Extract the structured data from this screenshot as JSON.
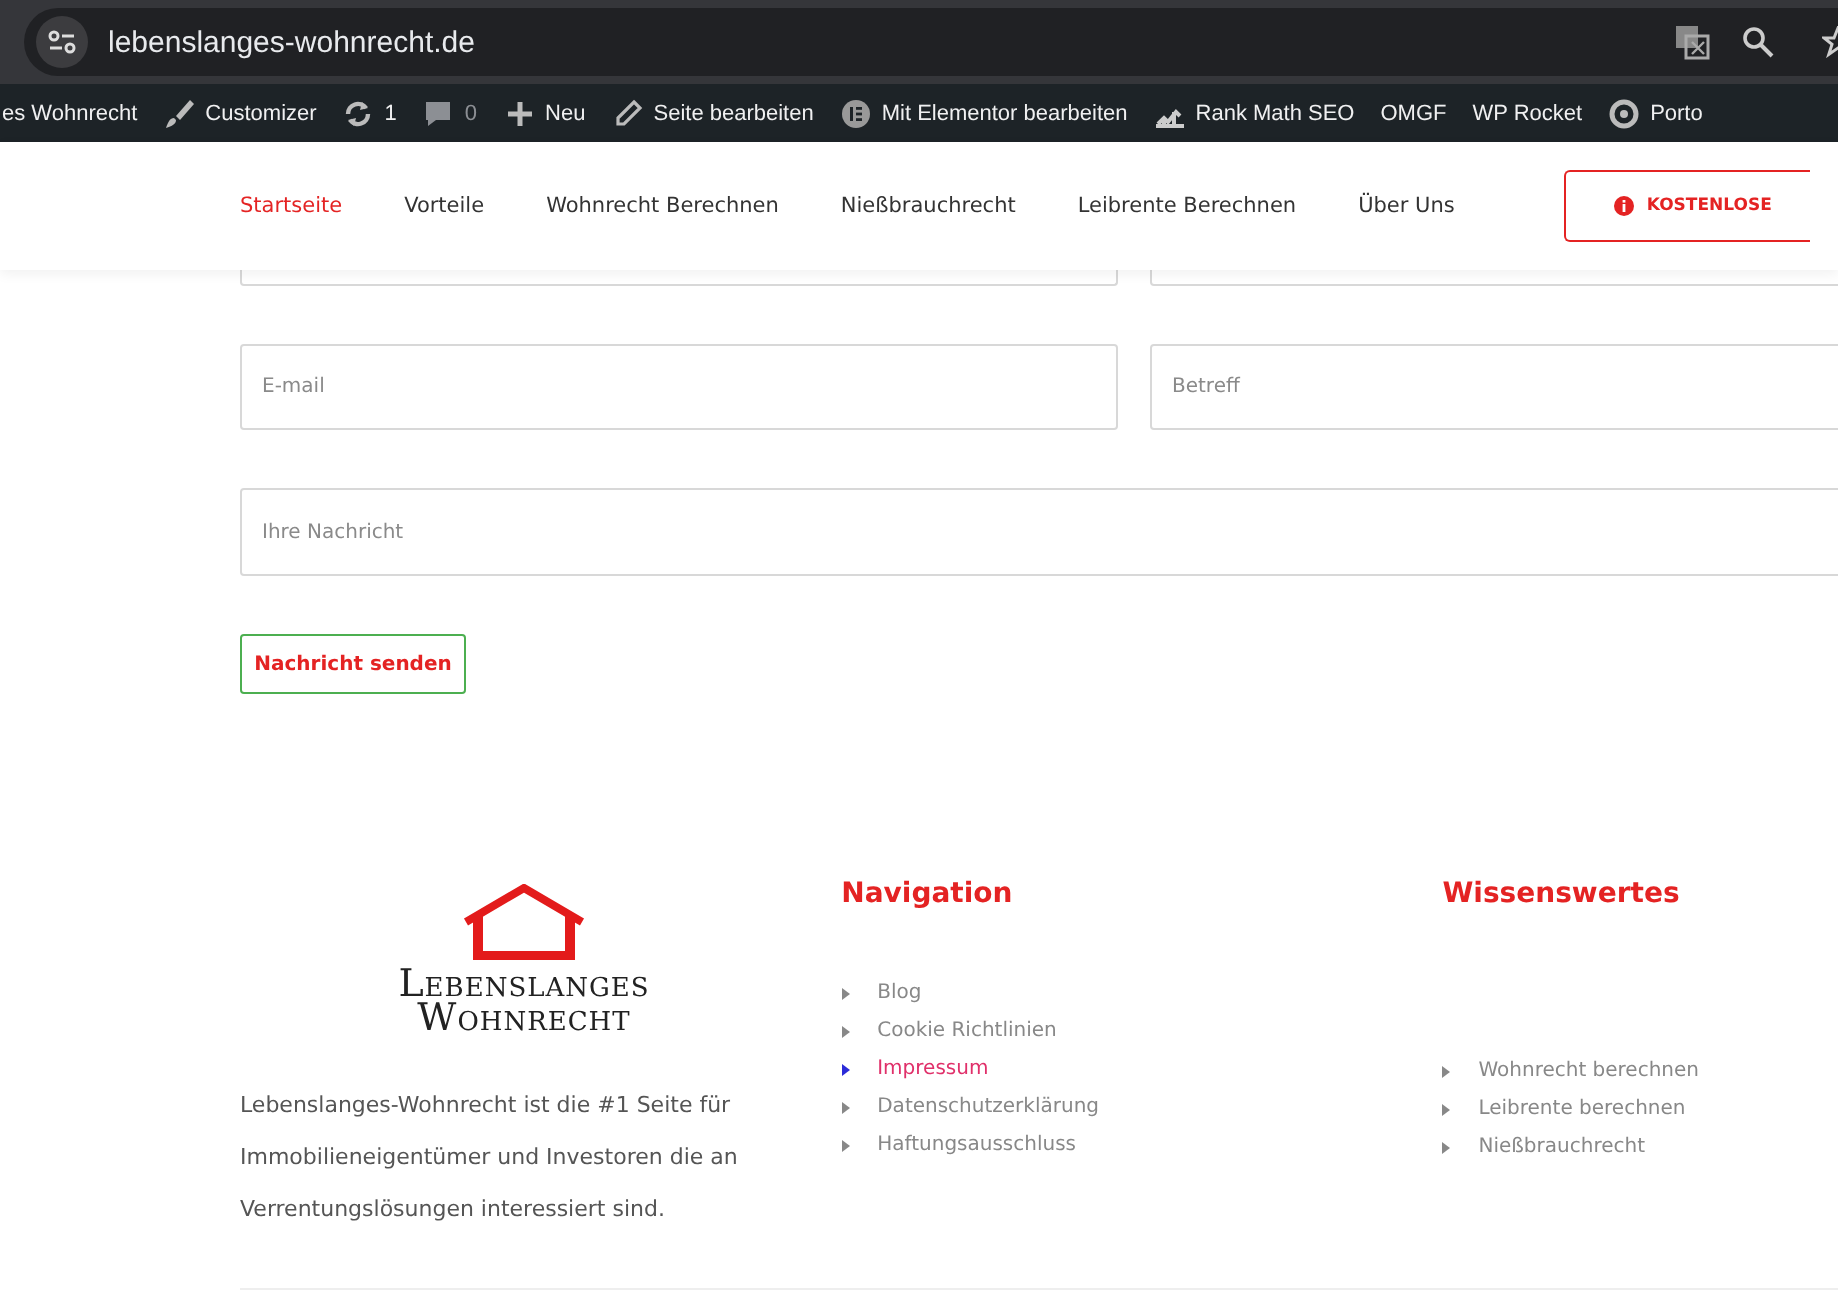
{
  "browser": {
    "url": "lebenslanges-wohnrecht.de"
  },
  "admin_bar": [
    {
      "kind": "site",
      "label": "es Wohnrecht"
    },
    {
      "kind": "brush",
      "label": "Customizer"
    },
    {
      "kind": "updates",
      "label": "1"
    },
    {
      "kind": "comments",
      "label": "0"
    },
    {
      "kind": "new",
      "label": "Neu"
    },
    {
      "kind": "edit",
      "label": "Seite bearbeiten"
    },
    {
      "kind": "elementor",
      "label": "Mit Elementor bearbeiten"
    },
    {
      "kind": "rankmath",
      "label": "Rank Math SEO"
    },
    {
      "kind": "text",
      "label": "OMGF"
    },
    {
      "kind": "text",
      "label": "WP Rocket"
    },
    {
      "kind": "porto",
      "label": "Porto"
    }
  ],
  "nav": [
    {
      "label": "Startseite",
      "selected": true
    },
    {
      "label": "Vorteile",
      "selected": false
    },
    {
      "label": "Wohnrecht Berechnen",
      "selected": false
    },
    {
      "label": "Nießbrauchrecht",
      "selected": false
    },
    {
      "label": "Leibrente Berechnen",
      "selected": false
    },
    {
      "label": "Über Uns",
      "selected": false
    }
  ],
  "header_button": "KOSTENLOSE",
  "form": {
    "email_placeholder": "E-mail",
    "subject_placeholder": "Betreff",
    "message_placeholder": "Ihre Nachricht",
    "submit": "Nachricht senden"
  },
  "footer": {
    "logo_line_1": "Lebenslanges",
    "logo_line_2": "Wohnrecht",
    "about": "Lebenslanges-Wohnrecht ist die #1 Seite für Immobilieneigentümer und Investoren die an Verrentungslösungen interessiert sind.",
    "navigation": {
      "title": "Navigation",
      "items": [
        {
          "label": "Blog",
          "selected": false
        },
        {
          "label": "Cookie Richtlinien",
          "selected": false
        },
        {
          "label": "Impressum",
          "selected": true
        },
        {
          "label": "Datenschutzerklärung",
          "selected": false
        },
        {
          "label": "Haftungsausschluss",
          "selected": false
        }
      ]
    },
    "knowledge": {
      "title": "Wissenswertes",
      "items": [
        {
          "label": "Wohnrecht berechnen",
          "selected": false
        },
        {
          "label": "Leibrente berechnen",
          "selected": false
        },
        {
          "label": "Nießbrauchrecht",
          "selected": false
        }
      ]
    }
  }
}
